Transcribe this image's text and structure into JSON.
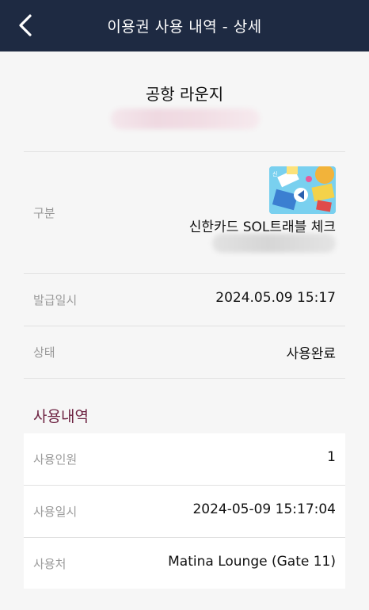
{
  "header": {
    "title": "이용권 사용 내역 - 상세",
    "back_icon": "chevron-left-icon"
  },
  "product": {
    "title": "공항 라운지"
  },
  "details": {
    "category_label": "구분",
    "card_name": "신한카드 SOL트래블 체크",
    "issued_label": "발급일시",
    "issued_value": "2024.05.09 15:17",
    "status_label": "상태",
    "status_value": "사용완료"
  },
  "usage": {
    "section_title": "사용내역",
    "people_label": "사용인원",
    "people_value": "1",
    "datetime_label": "사용일시",
    "datetime_value": "2024-05-09 15:17:04",
    "place_label": "사용처",
    "place_value": "Matina Lounge (Gate 11)"
  },
  "colors": {
    "header_bg": "#1e2a42",
    "accent": "#6e2443",
    "page_bg": "#f6f6f6"
  }
}
